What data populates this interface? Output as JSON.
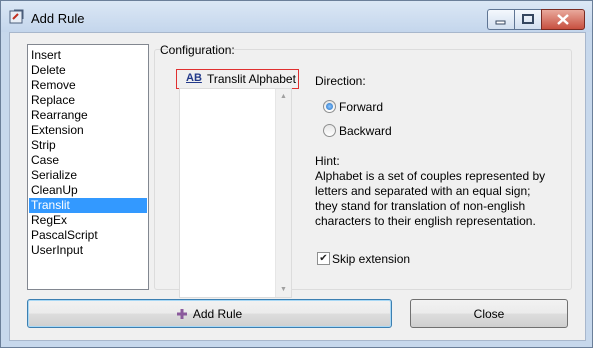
{
  "window": {
    "title": "Add Rule",
    "icon": "app-icon",
    "controls": [
      "minimize-icon",
      "maximize-icon",
      "close-icon"
    ]
  },
  "rules": [
    "Insert",
    "Delete",
    "Remove",
    "Replace",
    "Rearrange",
    "Extension",
    "Strip",
    "Case",
    "Serialize",
    "CleanUp",
    "Translit",
    "RegEx",
    "PascalScript",
    "UserInput"
  ],
  "selected_rule": "Translit",
  "configuration": {
    "label": "Configuration:",
    "alphabet_button": {
      "icon_text": "AB",
      "label": "Translit Alphabet"
    },
    "direction": {
      "label": "Direction:",
      "options": [
        "Forward",
        "Backward"
      ],
      "selected": "Forward"
    },
    "hint": {
      "label": "Hint:",
      "text": "Alphabet is a set of couples represented by letters and separated with an equal sign; they stand for translation of non-english characters to their english representation."
    },
    "skip_extension": {
      "label": "Skip extension",
      "checked": true
    }
  },
  "buttons": {
    "add_rule": "Add Rule",
    "close": "Close"
  }
}
